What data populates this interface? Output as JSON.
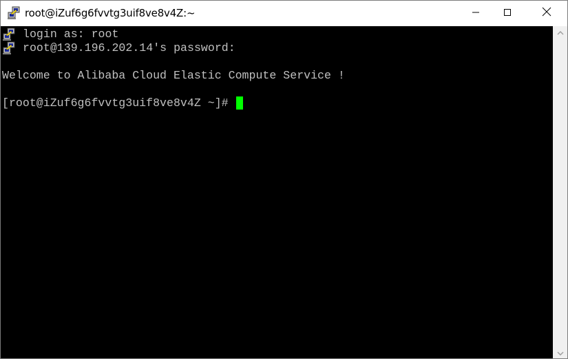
{
  "window": {
    "title": "root@iZuf6g6fvvtg3uif8ve8v4Z:~",
    "app_icon": "putty-icon",
    "controls": {
      "minimize": "minimize-icon",
      "maximize": "maximize-icon",
      "close": "close-icon"
    }
  },
  "terminal": {
    "lines": [
      {
        "icon": "putty-icon",
        "text": "login as: root"
      },
      {
        "icon": "putty-icon",
        "text": "root@139.196.202.14's password:"
      },
      {
        "icon": null,
        "text": ""
      },
      {
        "icon": null,
        "text": "Welcome to Alibaba Cloud Elastic Compute Service !"
      },
      {
        "icon": null,
        "text": ""
      },
      {
        "icon": null,
        "text": "[root@iZuf6g6fvvtg3uif8ve8v4Z ~]# "
      }
    ],
    "foreground_color": "#c0c0c0",
    "background_color": "#000000",
    "cursor_color": "#00ff00"
  },
  "scrollbar": {
    "up_icon": "chevron-up-icon",
    "down_icon": "chevron-down-icon"
  }
}
